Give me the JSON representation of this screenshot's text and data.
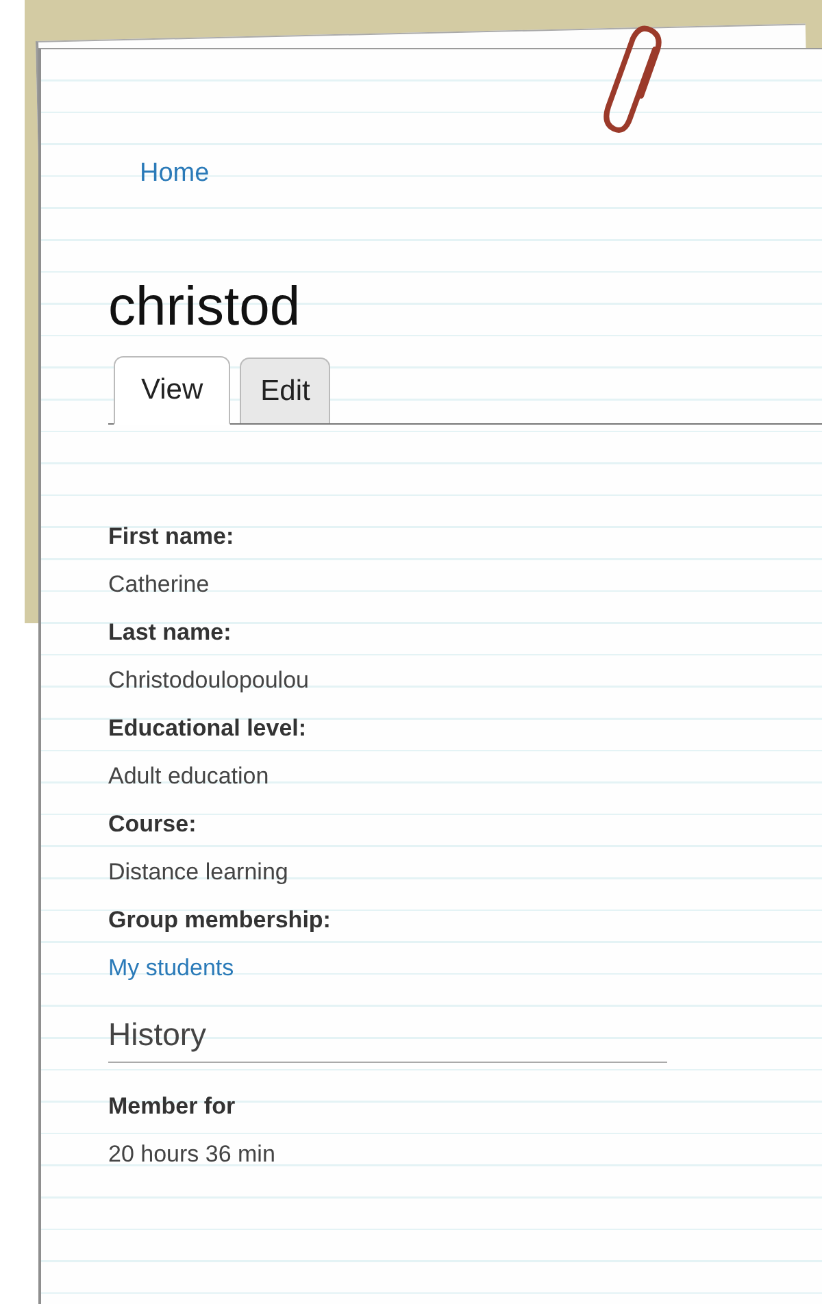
{
  "breadcrumb": {
    "label": "Home"
  },
  "title": "christod",
  "tabs": [
    {
      "label": "View",
      "selected": true
    },
    {
      "label": "Edit",
      "selected": false
    }
  ],
  "fields": [
    {
      "kind": "text",
      "label": "First name:",
      "value": "Catherine"
    },
    {
      "kind": "text",
      "label": "Last name:",
      "value": "Christodoulopoulou"
    },
    {
      "kind": "text",
      "label": "Educational level:",
      "value": "Adult education"
    },
    {
      "kind": "text",
      "label": "Course:",
      "value": "Distance learning"
    },
    {
      "kind": "link",
      "label": "Group membership:",
      "value": "My students"
    }
  ],
  "history": {
    "heading": "History",
    "label": "Member for",
    "value": "20 hours 36 min"
  }
}
